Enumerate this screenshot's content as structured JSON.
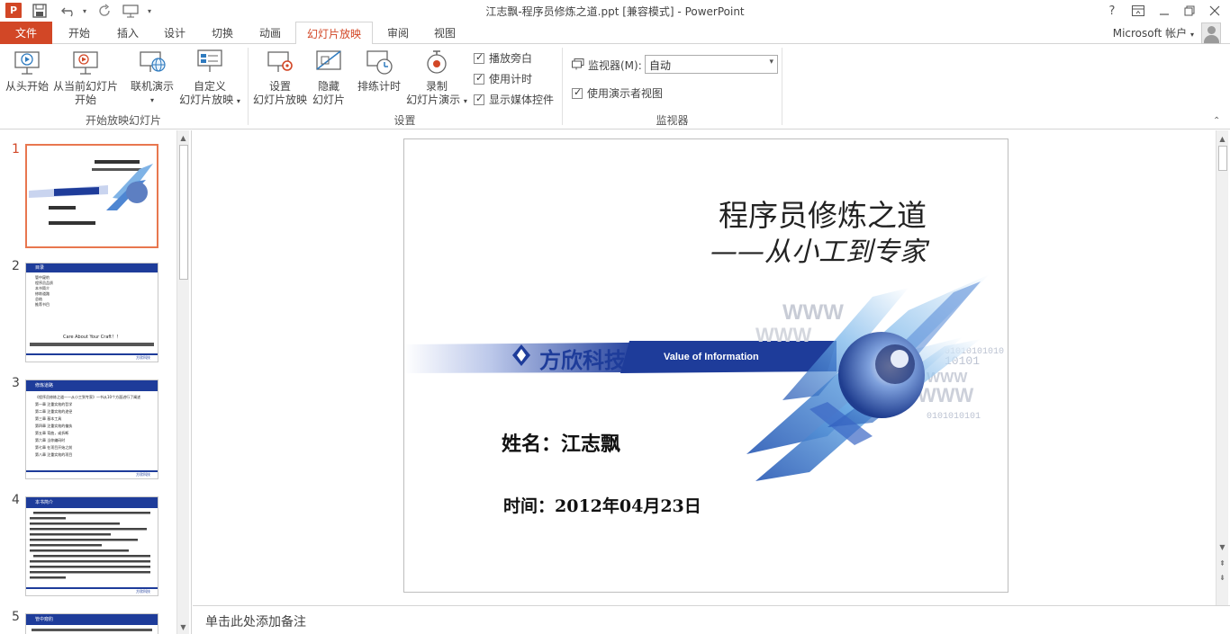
{
  "window": {
    "title": "江志飘-程序员修炼之道.ppt [兼容模式] - PowerPoint",
    "logo_text": "P",
    "help": "?",
    "controls": [
      "help",
      "ribbon-display",
      "minimize",
      "maximize",
      "close"
    ]
  },
  "tabs": {
    "file": "文件",
    "items": [
      "开始",
      "插入",
      "设计",
      "切换",
      "动画",
      "幻灯片放映",
      "审阅",
      "视图"
    ],
    "active": "幻灯片放映",
    "account": "Microsoft 帐户"
  },
  "ribbon": {
    "start_group": {
      "label": "开始放映幻灯片",
      "from_beginning": "从头开始",
      "from_current_1": "从当前幻灯片",
      "from_current_2": "开始",
      "online_1": "联机演示",
      "custom_1": "自定义",
      "custom_2": "幻灯片放映"
    },
    "setup_group": {
      "label": "设置",
      "setup_1": "设置",
      "setup_2": "幻灯片放映",
      "hide_1": "隐藏",
      "hide_2": "幻灯片",
      "rehearse": "排练计时",
      "record_1": "录制",
      "record_2": "幻灯片演示",
      "chk_narration": "播放旁白",
      "chk_timing": "使用计时",
      "chk_media": "显示媒体控件"
    },
    "monitor_group": {
      "label": "监视器",
      "monitor_label": "监视器(M):",
      "monitor_value": "自动",
      "chk_presenter": "使用演示者视图"
    }
  },
  "thumbnails": {
    "numbers": [
      "1",
      "2",
      "3",
      "4",
      "5"
    ],
    "selected": "1",
    "slide2_title": "目录",
    "slide2_bullets": [
      "管中窥豹",
      "程序员品质",
      "本书简介",
      "修炼道路",
      "总结",
      "推荐书目"
    ],
    "slide2_footer": "Care About Your Craft！！",
    "slide3_title": "修炼道路",
    "slide3_bullets": [
      "《程序员修炼之道——从小工到专家》一书从10个方面进行了阐述",
      "第一章 注重实效的哲学",
      "第二章 注重实效的途径",
      "第三章 基本工具",
      "第四章 注重实效的偏执",
      "第五章 弯曲，或折断",
      "第六章 当你编码时",
      "第七章 在项目开始之前",
      "第八章 注重实效的项目"
    ],
    "slide4_title": "本书简介",
    "slide5_title": "管中窥豹",
    "company_small": "方欣科技"
  },
  "slide": {
    "title": "程序员修炼之道",
    "subtitle": "——从小工到专家",
    "company": "方欣科技",
    "tagline": "Value of Information",
    "name_line": "姓名：江志飘",
    "time_line": "时间：2012年04月23日"
  },
  "notes": {
    "placeholder": "单击此处添加备注"
  },
  "colors": {
    "accent": "#d24726",
    "brand_blue": "#1e3c9a",
    "selected_border": "#e8774f"
  }
}
